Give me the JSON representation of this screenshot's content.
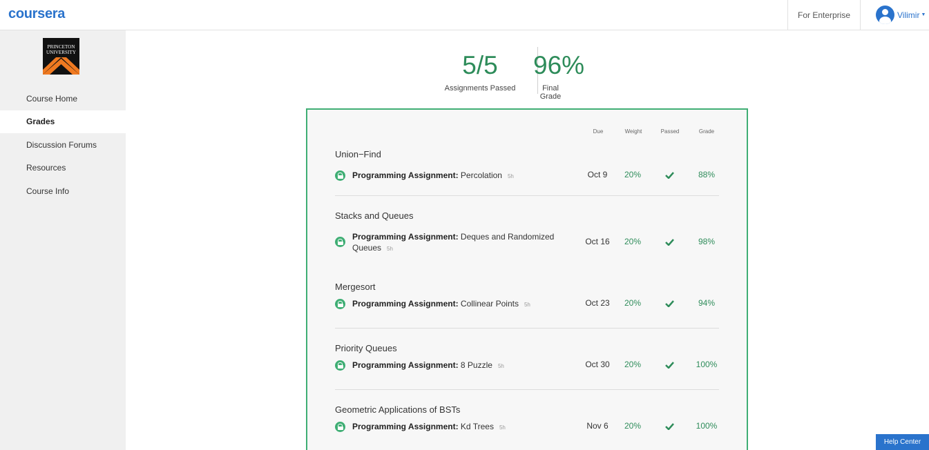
{
  "header": {
    "logo_text": "coursera",
    "enterprise_label": "For Enterprise",
    "user_name": "Vilimir",
    "brand_color": "#2a73cc"
  },
  "sidebar": {
    "university_logo_text": "PRINCETON UNIVERSITY",
    "items": [
      {
        "label": "Course Home",
        "active": false
      },
      {
        "label": "Grades",
        "active": true
      },
      {
        "label": "Discussion Forums",
        "active": false
      },
      {
        "label": "Resources",
        "active": false
      },
      {
        "label": "Course Info",
        "active": false
      }
    ]
  },
  "summary": {
    "passed_value": "5/5",
    "passed_label": "Assignments Passed",
    "grade_value": "96%",
    "grade_label": "Final Grade",
    "accent_color": "#2e8c5a"
  },
  "table": {
    "columns": {
      "due": "Due",
      "weight": "Weight",
      "passed": "Passed",
      "grade": "Grade"
    },
    "sections": [
      {
        "title": "Union−Find",
        "assignment_type": "Programming Assignment:",
        "assignment_name": "Percolation",
        "duration": "5h",
        "due": "Oct 9",
        "weight": "20%",
        "passed": true,
        "grade": "88%"
      },
      {
        "title": "Stacks and Queues",
        "assignment_type": "Programming Assignment:",
        "assignment_name": "Deques and Randomized Queues",
        "name_line1": "Deques and Randomized",
        "name_line2": "Queues",
        "duration": "5h",
        "due": "Oct 16",
        "weight": "20%",
        "passed": true,
        "grade": "98%"
      },
      {
        "title": "Mergesort",
        "assignment_type": "Programming Assignment:",
        "assignment_name": "Collinear Points",
        "duration": "5h",
        "due": "Oct 23",
        "weight": "20%",
        "passed": true,
        "grade": "94%"
      },
      {
        "title": "Priority Queues",
        "assignment_type": "Programming Assignment:",
        "assignment_name": "8 Puzzle",
        "duration": "5h",
        "due": "Oct 30",
        "weight": "20%",
        "passed": true,
        "grade": "100%"
      },
      {
        "title": "Geometric Applications of BSTs",
        "assignment_type": "Programming Assignment:",
        "assignment_name": "Kd Trees",
        "duration": "5h",
        "due": "Nov 6",
        "weight": "20%",
        "passed": true,
        "grade": "100%"
      }
    ],
    "icons": {
      "lock": "lock-icon",
      "check": "checkmark-icon"
    }
  },
  "help": {
    "label": "Help Center"
  }
}
